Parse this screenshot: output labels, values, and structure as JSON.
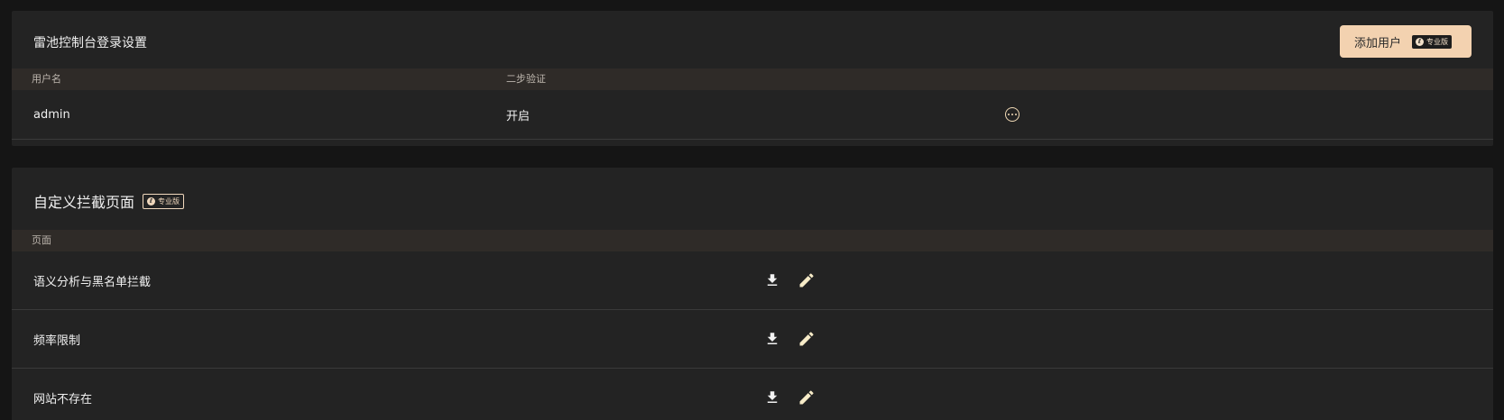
{
  "login_settings": {
    "title": "雷池控制台登录设置",
    "add_user_label": "添加用户",
    "pro_badge": "专业版",
    "columns": {
      "username": "用户名",
      "two_factor": "二步验证"
    },
    "rows": [
      {
        "username": "admin",
        "two_factor": "开启"
      }
    ]
  },
  "custom_block_pages": {
    "title": "自定义拦截页面",
    "pro_badge": "专业版",
    "columns": {
      "page": "页面"
    },
    "rows": [
      {
        "name": "语义分析与黑名单拦截"
      },
      {
        "name": "频率限制"
      },
      {
        "name": "网站不存在"
      }
    ]
  },
  "colors": {
    "accent": "#f3d2b0",
    "background": "#151515",
    "card": "#232323",
    "header_row": "#2f2b28"
  },
  "icons": {
    "row_more": "more-circle-icon",
    "download": "download-icon",
    "edit": "pencil-icon",
    "pro_logo": "leichi-logo-icon"
  }
}
